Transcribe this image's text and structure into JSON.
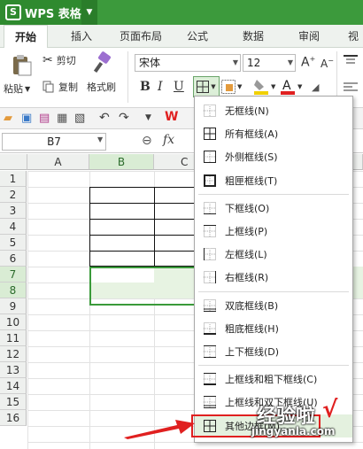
{
  "app": {
    "name": "WPS 表格"
  },
  "tabs": [
    {
      "label": "开始",
      "active": true
    },
    {
      "label": "插入"
    },
    {
      "label": "页面布局"
    },
    {
      "label": "公式"
    },
    {
      "label": "数据"
    },
    {
      "label": "审阅"
    },
    {
      "label": "视"
    }
  ],
  "ribbon": {
    "paste": "粘贴",
    "cut": "剪切",
    "copy": "复制",
    "format_painter": "格式刷",
    "font_name": "宋体",
    "font_size": "12",
    "bold": "B",
    "italic": "I",
    "underline": "U"
  },
  "formula_bar": {
    "cell_ref": "B7",
    "fx": "fx"
  },
  "columns": [
    "A",
    "B",
    "C"
  ],
  "rows": [
    "1",
    "2",
    "3",
    "4",
    "5",
    "6",
    "7",
    "8",
    "9",
    "10",
    "11",
    "12",
    "13",
    "14",
    "15",
    "16"
  ],
  "selected_rows": [
    "7",
    "8"
  ],
  "selected_column": "B",
  "border_menu": {
    "items": [
      {
        "label": "无框线(N)",
        "icon": "no-border-icon"
      },
      {
        "label": "所有框线(A)",
        "icon": "all-borders-icon"
      },
      {
        "label": "外侧框线(S)",
        "icon": "outside-borders-icon"
      },
      {
        "label": "粗匣框线(T)",
        "icon": "thick-box-border-icon"
      },
      {
        "label": "下框线(O)",
        "icon": "bottom-border-icon"
      },
      {
        "label": "上框线(P)",
        "icon": "top-border-icon"
      },
      {
        "label": "左框线(L)",
        "icon": "left-border-icon"
      },
      {
        "label": "右框线(R)",
        "icon": "right-border-icon"
      },
      {
        "label": "双底框线(B)",
        "icon": "double-bottom-border-icon"
      },
      {
        "label": "粗底框线(H)",
        "icon": "thick-bottom-border-icon"
      },
      {
        "label": "上下框线(D)",
        "icon": "top-bottom-border-icon"
      },
      {
        "label": "上框线和粗下框线(C)",
        "icon": "top-thick-bottom-border-icon"
      },
      {
        "label": "上框线和双下框线(U)",
        "icon": "top-double-bottom-border-icon"
      },
      {
        "label": "其他边框(M)...",
        "icon": "more-borders-icon"
      }
    ]
  },
  "watermark": {
    "line1": "经验啦",
    "line2": "jingyanla.com",
    "check": "√"
  },
  "colors": {
    "accent": "#3c9a3c",
    "selection": "#3a9a3a",
    "arrow": "#e02020"
  }
}
